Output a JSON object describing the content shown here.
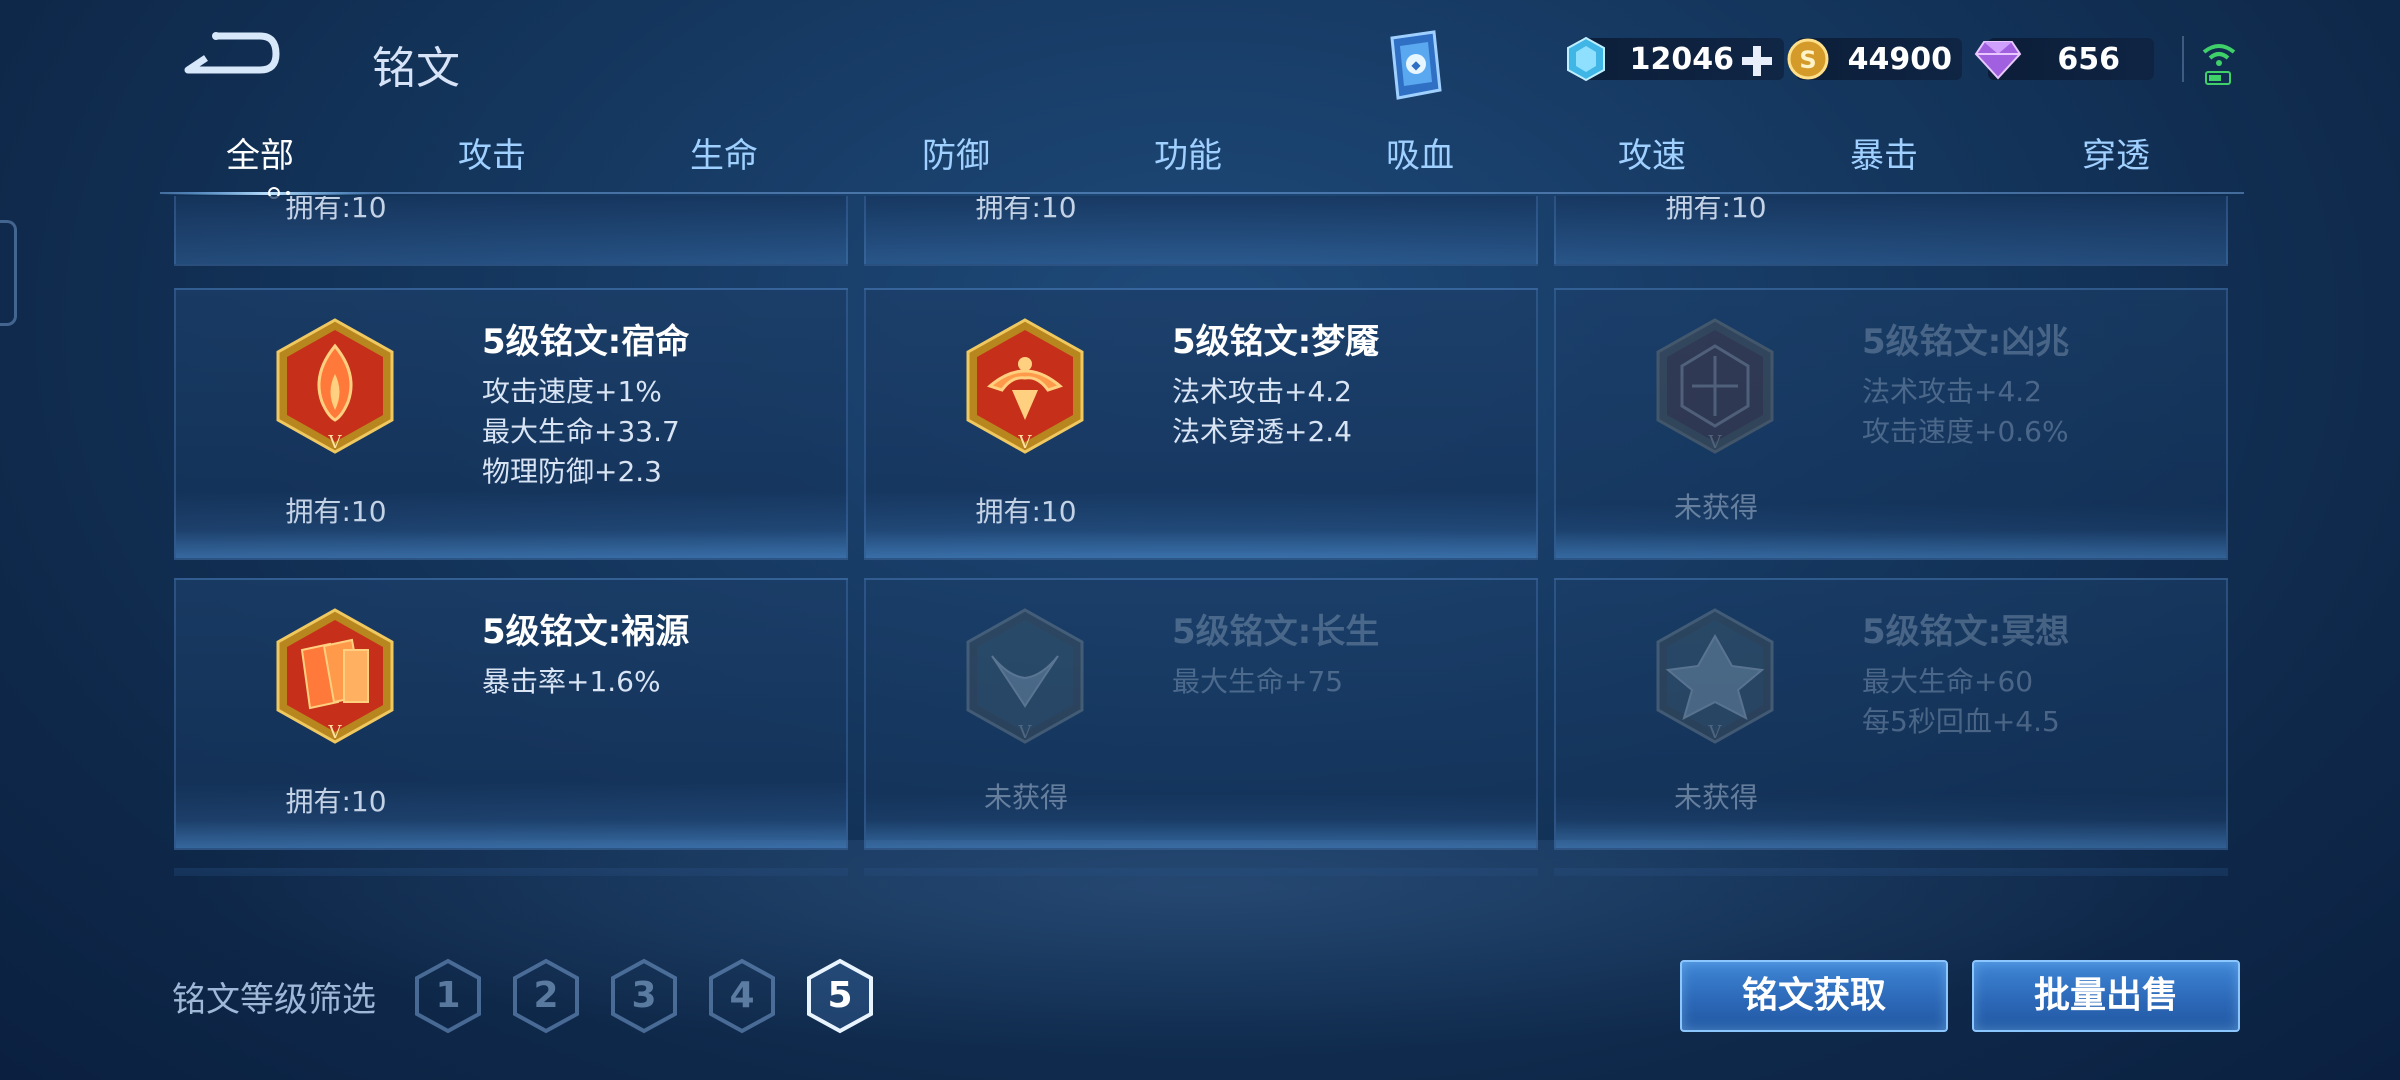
{
  "header": {
    "title": "铭文",
    "currencies": [
      {
        "name": "点券",
        "icon": "coupon-icon",
        "value": "12046",
        "has_add": true
      },
      {
        "name": "金币",
        "icon": "gold-coin-icon",
        "value": "44900"
      },
      {
        "name": "钻石",
        "icon": "diamond-icon",
        "value": "656"
      }
    ]
  },
  "tabs": [
    {
      "label": "全部",
      "active": true
    },
    {
      "label": "攻击"
    },
    {
      "label": "生命"
    },
    {
      "label": "防御"
    },
    {
      "label": "功能"
    },
    {
      "label": "吸血"
    },
    {
      "label": "攻速"
    },
    {
      "label": "暴击"
    },
    {
      "label": "穿透"
    }
  ],
  "partial_row": [
    {
      "count": "拥有:10"
    },
    {
      "count": "拥有:10"
    },
    {
      "count": "拥有:10"
    }
  ],
  "runes": [
    {
      "name": "5级铭文:宿命",
      "stats": [
        "攻击速度+1%",
        "最大生命+33.7",
        "物理防御+2.3"
      ],
      "count": "拥有:10",
      "owned": true,
      "color": "#c6301a",
      "icon": "flame-rune-icon"
    },
    {
      "name": "5级铭文:梦魇",
      "stats": [
        "法术攻击+4.2",
        "法术穿透+2.4"
      ],
      "count": "拥有:10",
      "owned": true,
      "color": "#c6301a",
      "icon": "nightmare-rune-icon"
    },
    {
      "name": "5级铭文:凶兆",
      "stats": [
        "法术攻击+4.2",
        "攻击速度+0.6%"
      ],
      "count": "未获得",
      "owned": false,
      "color": "#8a2a2a",
      "icon": "omen-rune-icon"
    },
    {
      "name": "5级铭文:祸源",
      "stats": [
        "暴击率+1.6%"
      ],
      "count": "拥有:10",
      "owned": true,
      "color": "#c6301a",
      "icon": "cards-rune-icon"
    },
    {
      "name": "5级铭文:长生",
      "stats": [
        "最大生命+75"
      ],
      "count": "未获得",
      "owned": false,
      "color": "#2a6a8a",
      "icon": "longevity-rune-icon"
    },
    {
      "name": "5级铭文:冥想",
      "stats": [
        "最大生命+60",
        "每5秒回血+4.5"
      ],
      "count": "未获得",
      "owned": false,
      "color": "#2a6a8a",
      "icon": "meditation-rune-icon"
    }
  ],
  "footer": {
    "filter_label": "铭文等级筛选",
    "levels": [
      "1",
      "2",
      "3",
      "4",
      "5"
    ],
    "active_level": "5",
    "get_button": "铭文获取",
    "sell_button": "批量出售"
  },
  "colors": {
    "tab_text": "#9fd0ff",
    "button_bg": "#3f86d6",
    "owned_rune": "#c6301a"
  }
}
